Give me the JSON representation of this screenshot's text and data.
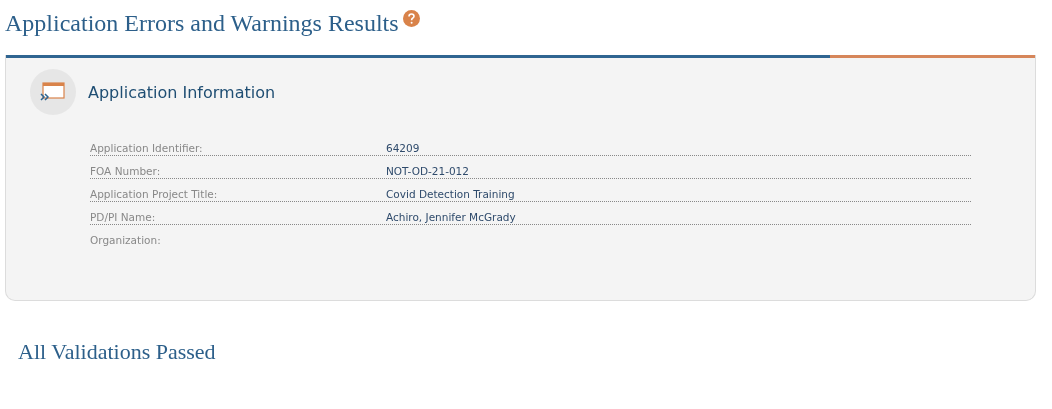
{
  "page_title": "Application Errors and Warnings Results",
  "panel": {
    "title": "Application Information",
    "rows": [
      {
        "label": "Application Identifier:",
        "value": "64209"
      },
      {
        "label": "FOA Number:",
        "value": "NOT-OD-21-012"
      },
      {
        "label": "Application Project Title:",
        "value": "Covid Detection Training"
      },
      {
        "label": "PD/PI Name:",
        "value": "Achiro, Jennifer McGrady"
      },
      {
        "label": "Organization:"
      }
    ]
  },
  "result_heading": "All Validations Passed"
}
